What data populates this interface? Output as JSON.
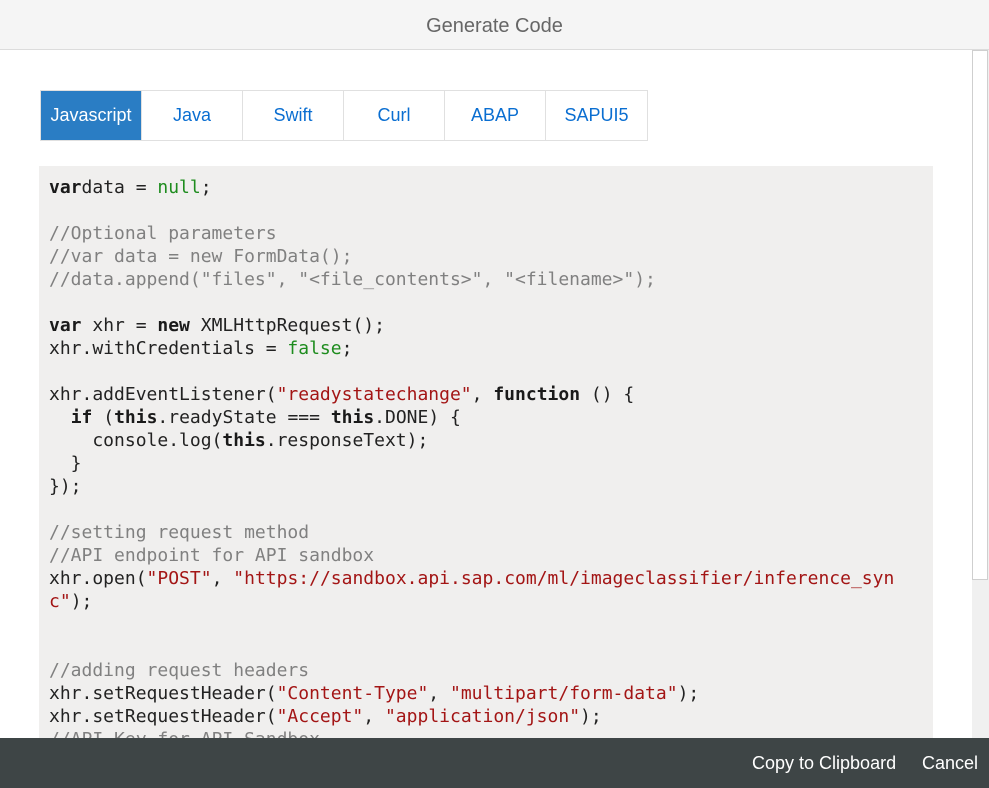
{
  "dialog": {
    "title": "Generate Code"
  },
  "tabs": [
    {
      "label": "Javascript",
      "active": true
    },
    {
      "label": "Java",
      "active": false
    },
    {
      "label": "Swift",
      "active": false
    },
    {
      "label": "Curl",
      "active": false
    },
    {
      "label": "ABAP",
      "active": false
    },
    {
      "label": "SAPUI5",
      "active": false
    }
  ],
  "code": {
    "lines": [
      [
        [
          "kw",
          "var"
        ],
        [
          "",
          "data = "
        ],
        [
          "lit",
          "null"
        ],
        [
          "",
          ";"
        ]
      ],
      [],
      [
        [
          "cm",
          "//Optional parameters"
        ]
      ],
      [
        [
          "cm",
          "//var data = new FormData();"
        ]
      ],
      [
        [
          "cm",
          "//data.append(\"files\", \"<file_contents>\", \"<filename>\");"
        ]
      ],
      [],
      [
        [
          "kw",
          "var"
        ],
        [
          "",
          " xhr = "
        ],
        [
          "kw",
          "new"
        ],
        [
          "",
          " XMLHttpRequest();"
        ]
      ],
      [
        [
          "",
          "xhr.withCredentials = "
        ],
        [
          "lit",
          "false"
        ],
        [
          "",
          ";"
        ]
      ],
      [],
      [
        [
          "",
          "xhr.addEventListener("
        ],
        [
          "str",
          "\"readystatechange\""
        ],
        [
          "",
          ", "
        ],
        [
          "kw",
          "function"
        ],
        [
          "",
          " () {"
        ]
      ],
      [
        [
          "",
          "  "
        ],
        [
          "kw",
          "if"
        ],
        [
          "",
          " ("
        ],
        [
          "kw",
          "this"
        ],
        [
          "",
          ".readyState === "
        ],
        [
          "kw",
          "this"
        ],
        [
          "",
          ".DONE) {"
        ]
      ],
      [
        [
          "",
          "    console.log("
        ],
        [
          "kw",
          "this"
        ],
        [
          "",
          ".responseText);"
        ]
      ],
      [
        [
          "",
          "  }"
        ]
      ],
      [
        [
          "",
          "});"
        ]
      ],
      [],
      [
        [
          "cm",
          "//setting request method"
        ]
      ],
      [
        [
          "cm",
          "//API endpoint for API sandbox"
        ]
      ],
      [
        [
          "",
          "xhr.open("
        ],
        [
          "str",
          "\"POST\""
        ],
        [
          "",
          ", "
        ],
        [
          "str",
          "\"https://sandbox.api.sap.com/ml/imageclassifier/inference_syn"
        ]
      ],
      [
        [
          "str",
          "c\""
        ],
        [
          "",
          ");"
        ]
      ],
      [],
      [],
      [
        [
          "cm",
          "//adding request headers"
        ]
      ],
      [
        [
          "",
          "xhr.setRequestHeader("
        ],
        [
          "str",
          "\"Content-Type\""
        ],
        [
          "",
          ", "
        ],
        [
          "str",
          "\"multipart/form-data\""
        ],
        [
          "",
          ");"
        ]
      ],
      [
        [
          "",
          "xhr.setRequestHeader("
        ],
        [
          "str",
          "\"Accept\""
        ],
        [
          "",
          ", "
        ],
        [
          "str",
          "\"application/json\""
        ],
        [
          "",
          ");"
        ]
      ],
      [
        [
          "cm",
          "//API Key for API Sandbox"
        ]
      ]
    ]
  },
  "footer": {
    "copy_label": "Copy to Clipboard",
    "cancel_label": "Cancel"
  }
}
